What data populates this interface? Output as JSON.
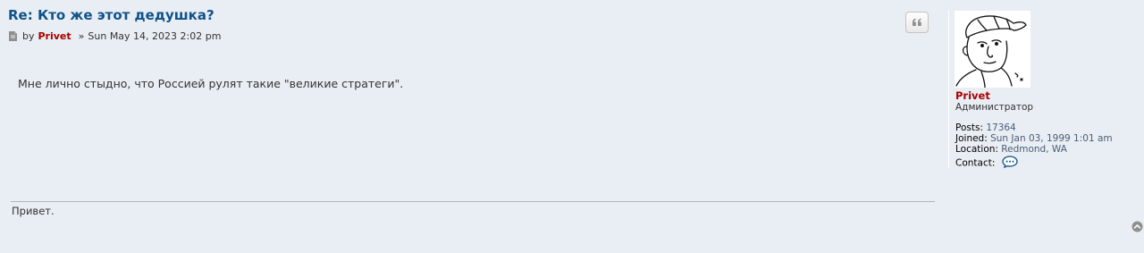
{
  "post": {
    "title": "Re: Кто же этот дедушка?",
    "meta": {
      "by_label": "by",
      "author": "Privet",
      "separator": "»",
      "date": "Sun May 14, 2023 2:02 pm"
    },
    "body": "Мне лично стыдно, что Россией рулят такие \"великие стратеги\".",
    "signature": "Привет.",
    "quote_icon": "quote-icon"
  },
  "profile": {
    "username": "Privet",
    "rank": "Администратор",
    "fields": {
      "posts_label": "Posts:",
      "posts_value": "17364",
      "joined_label": "Joined:",
      "joined_value": "Sun Jan 03, 1999 1:01 am",
      "location_label": "Location:",
      "location_value": "Redmond, WA",
      "contact_label": "Contact:"
    },
    "contact_icon": "speech-bubble-icon"
  },
  "colors": {
    "background": "#e8eef3",
    "title": "#105289",
    "username": "#aa0000",
    "field_value": "#4c5d77"
  }
}
